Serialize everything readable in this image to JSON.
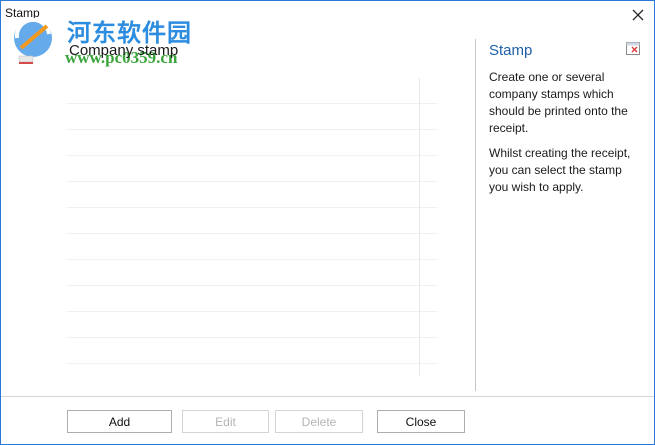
{
  "window": {
    "title": "Stamp"
  },
  "watermark": {
    "site_name": "河东软件园",
    "url": "www.pc0359.cn"
  },
  "list": {
    "header": "Company stamp",
    "rows": [
      "",
      "",
      "",
      "",
      "",
      "",
      "",
      "",
      "",
      "",
      ""
    ]
  },
  "help": {
    "title": "Stamp",
    "paragraphs": [
      "Create one or several company stamps which should be printed onto the receipt.",
      "Whilst creating the receipt, you can select the stamp you wish to apply."
    ]
  },
  "buttons": {
    "add": "Add",
    "edit": "Edit",
    "delete": "Delete",
    "close": "Close"
  },
  "icons": {
    "close": "close-icon",
    "pin": "panel-toggle-icon",
    "logo": "watermark-logo-icon"
  },
  "colors": {
    "window_border": "#2b79d6",
    "help_title": "#1e5fa8",
    "watermark_cn": "#2c8de0",
    "watermark_url": "#3aa53a",
    "pin_accent": "#e03b3b"
  }
}
